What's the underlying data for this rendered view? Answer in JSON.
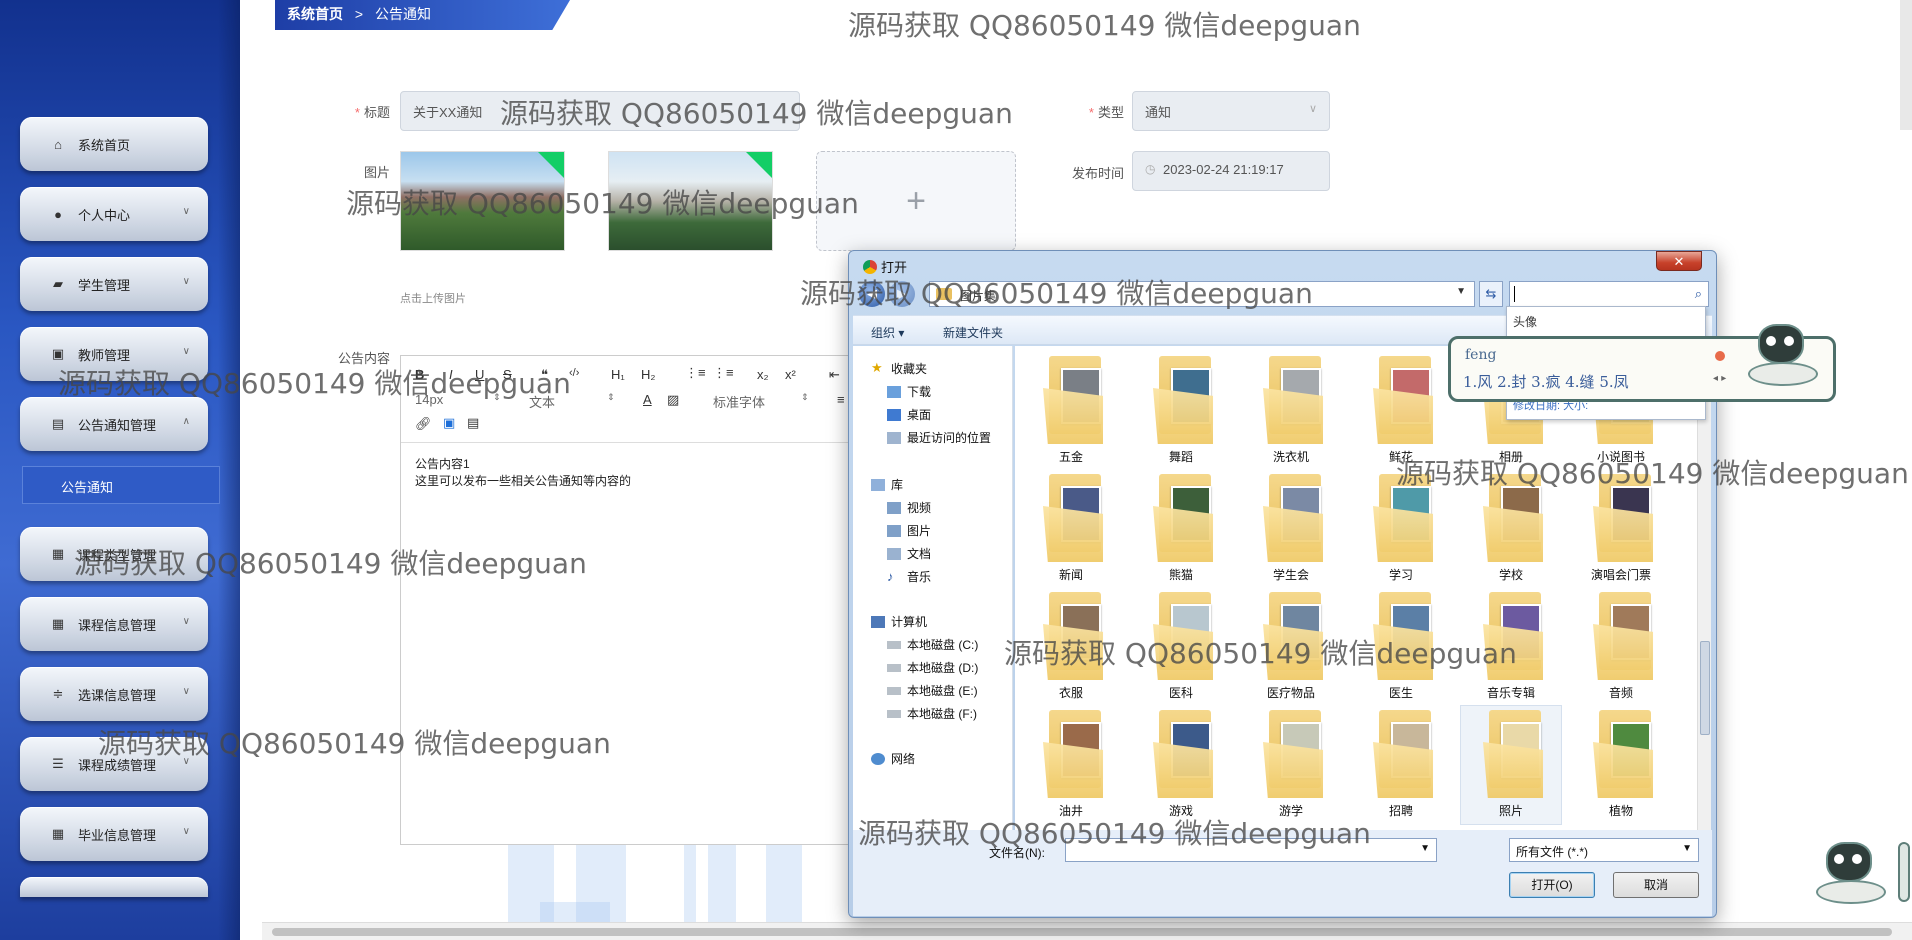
{
  "breadcrumb": {
    "home": "系统首页",
    "separator": ">",
    "current": "公告通知"
  },
  "sidebar": {
    "items": [
      {
        "label": "系统首页",
        "icon": "home-icon"
      },
      {
        "label": "个人中心",
        "icon": "user-icon"
      },
      {
        "label": "学生管理",
        "icon": "briefcase-icon"
      },
      {
        "label": "教师管理",
        "icon": "car-icon"
      },
      {
        "label": "公告通知管理",
        "icon": "clipboard-icon"
      },
      {
        "label": "课程类型管理",
        "icon": "grid-icon"
      },
      {
        "label": "课程信息管理",
        "icon": "grid-icon"
      },
      {
        "label": "选课信息管理",
        "icon": "sliders-icon"
      },
      {
        "label": "课程成绩管理",
        "icon": "list-icon"
      },
      {
        "label": "毕业信息管理",
        "icon": "grid-icon"
      }
    ],
    "active_sub": "公告通知"
  },
  "form": {
    "title_label": "标题",
    "title_value": "关于XX通知",
    "type_label": "类型",
    "type_value": "通知",
    "image_label": "图片",
    "upload_hint": "点击上传图片",
    "upload_plus": "+",
    "time_label": "发布时间",
    "time_value": "2023-02-24 21:19:17",
    "content_label": "公告内容"
  },
  "editor": {
    "toolbar_row1": [
      "B",
      "I",
      "U",
      "S",
      "❝",
      "‹/›",
      "H₁",
      "H₂",
      "x₂",
      "x²"
    ],
    "font_size": "14px",
    "text_type": "文本",
    "font_face": "标准字体",
    "content_line1": "公告内容1",
    "content_line2": "这里可以发布一些相关公告通知等内容的"
  },
  "dialog": {
    "title": "打开",
    "close": "✕",
    "address": "图片集",
    "toolbar": {
      "organize": "组织 ▾",
      "new_folder": "新建文件夹"
    },
    "nav_pane": {
      "favorites": "收藏夹",
      "fav_items": [
        "下载",
        "桌面",
        "最近访问的位置"
      ],
      "libraries": "库",
      "lib_items": [
        "视频",
        "图片",
        "文档",
        "音乐"
      ],
      "computer": "计算机",
      "drives": [
        "本地磁盘 (C:)",
        "本地磁盘 (D:)",
        "本地磁盘 (E:)",
        "本地磁盘 (F:)"
      ],
      "network": "网络"
    },
    "folders": [
      "五金",
      "舞蹈",
      "洗衣机",
      "鲜花",
      "相册",
      "小说图书",
      "新闻",
      "熊猫",
      "学生会",
      "学习",
      "学校",
      "演唱会门票",
      "衣服",
      "医科",
      "医疗物品",
      "医生",
      "音乐专辑",
      "音频",
      "油井",
      "游戏",
      "游学",
      "招聘",
      "照片",
      "植物"
    ],
    "filename_label": "文件名(N):",
    "filename_value": "",
    "filetype": "所有文件 (*.*)",
    "open_button": "打开(O)",
    "cancel_button": "取消"
  },
  "search_dropdown": {
    "item": "头像",
    "footer": "修改日期:  大小:"
  },
  "ime": {
    "input": "feng",
    "candidates": "1.风  2.封  3.疯  4.缝  5.凤"
  },
  "watermarks": [
    "源码获取 QQ86050149 微信deepguan",
    "源码获取 QQ86050149 微信deepguan",
    "源码获取 QQ86050149 微信deepguan",
    "源码获取 QQ86050149 微信deepguan",
    "源码获取 QQ86050149 微信deepguan",
    "源码获取 QQ86050149 微信deepguan",
    "源码获取 QQ86050149 微信deepguan",
    "源码获取 QQ86050149 微信deepguan",
    "源码获取 QQ86050149 微信deepguan",
    "源码获取 QQ86050149 微信deepguan"
  ]
}
